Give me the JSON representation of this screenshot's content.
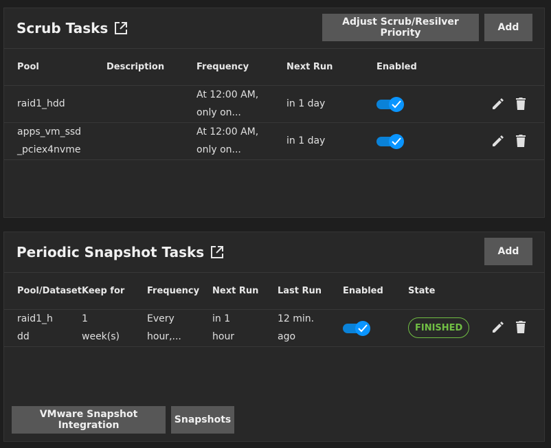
{
  "scrub": {
    "title": "Scrub Tasks",
    "adjust_label": "Adjust Scrub/Resilver Priority",
    "add_label": "Add",
    "columns": [
      "Pool",
      "Description",
      "Frequency",
      "Next Run",
      "Enabled"
    ],
    "rows": [
      {
        "pool_line1": "raid1_hdd",
        "pool_line2": "",
        "description": "",
        "freq_line1": "At 12:00 AM,",
        "freq_line2": "only on...",
        "next_run": "in 1 day",
        "enabled": true
      },
      {
        "pool_line1": "apps_vm_ssd",
        "pool_line2": "_pciex4nvme",
        "description": "",
        "freq_line1": "At 12:00 AM,",
        "freq_line2": "only on...",
        "next_run": "in 1 day",
        "enabled": true
      }
    ]
  },
  "snapshot": {
    "title": "Periodic Snapshot Tasks",
    "add_label": "Add",
    "columns": [
      "Pool/Dataset",
      "Keep for",
      "Frequency",
      "Next Run",
      "Last Run",
      "Enabled",
      "State"
    ],
    "rows": [
      {
        "pool_line1": "raid1_h",
        "pool_line2": "dd",
        "keep_line1": "1",
        "keep_line2": "week(s)",
        "freq_line1": "Every",
        "freq_line2": "hour,...",
        "next_line1": "in 1",
        "next_line2": "hour",
        "last_line1": "12 min.",
        "last_line2": "ago",
        "enabled": true,
        "state": "FINISHED"
      }
    ],
    "vmware_label": "VMware Snapshot Integration",
    "snapshots_label": "Snapshots"
  },
  "colors": {
    "toggle_on": "#0a95ff",
    "state_finished": "#71bf44"
  },
  "icons": [
    "open-in-new-icon",
    "check-icon",
    "pencil-icon",
    "delete-icon"
  ]
}
